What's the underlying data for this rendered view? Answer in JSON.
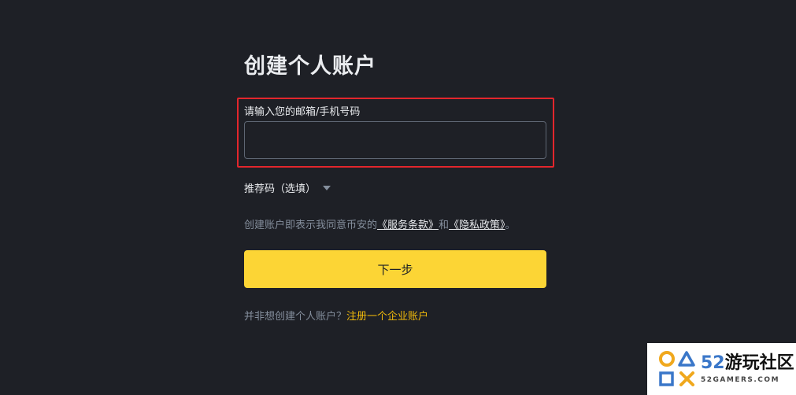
{
  "form": {
    "title": "创建个人账户",
    "email_label": "请输入您的邮箱/手机号码",
    "email_value": "",
    "referral_label": "推荐码（选填）",
    "terms_prefix": "创建账户即表示我同意币安的",
    "terms_link": "《服务条款》",
    "terms_and": "和",
    "privacy_link": "《隐私政策》",
    "terms_suffix": "。",
    "next_button": "下一步",
    "business_prompt": "并非想创建个人账户？",
    "business_link": "注册一个企业账户"
  },
  "watermark": {
    "num": "52",
    "name": "游玩社区",
    "site": "52GAMERS.COM"
  },
  "colors": {
    "background": "#1e2026",
    "accent": "#fcd535",
    "link_accent": "#f0b90b",
    "highlight": "#e3262c"
  }
}
